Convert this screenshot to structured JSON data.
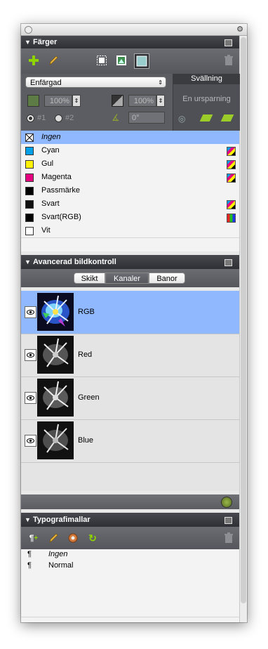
{
  "colors_panel": {
    "title": "Färger",
    "toolbar_icons": [
      "plus-icon",
      "pencil-icon",
      "frame-icon",
      "image-frame-icon",
      "box-fill-icon",
      "trash-icon"
    ],
    "mode_select": "Enfärgad",
    "shade_left": "100%",
    "shade_right": "100%",
    "color1_label": "#1",
    "color2_label": "#2",
    "angle": "0°",
    "blend_header": "Svällning",
    "blend_value": "En ursparning",
    "colors": [
      {
        "name": "Ingen",
        "swatch": "none",
        "badge": "",
        "selected": true,
        "italic": true
      },
      {
        "name": "Cyan",
        "swatch": "#00a0e9",
        "badge": "cmyk"
      },
      {
        "name": "Gul",
        "swatch": "#fff200",
        "badge": "cmyk"
      },
      {
        "name": "Magenta",
        "swatch": "#e4007f",
        "badge": "cmyk"
      },
      {
        "name": "Passmärke",
        "swatch": "#000000",
        "badge": ""
      },
      {
        "name": "Svart",
        "swatch": "#111111",
        "badge": "cmyk"
      },
      {
        "name": "Svart(RGB)",
        "swatch": "#000000",
        "badge": "rgb"
      },
      {
        "name": "Vit",
        "swatch": "#ffffff",
        "badge": ""
      }
    ]
  },
  "image_panel": {
    "title": "Avancerad bildkontroll",
    "tabs": [
      "Skikt",
      "Kanaler",
      "Banor"
    ],
    "active_tab": "Kanaler",
    "channels": [
      {
        "name": "RGB",
        "selected": true
      },
      {
        "name": "Red",
        "selected": false
      },
      {
        "name": "Green",
        "selected": false
      },
      {
        "name": "Blue",
        "selected": false
      }
    ]
  },
  "typo_panel": {
    "title": "Typografimallar",
    "styles": [
      {
        "mark": "¶",
        "name": "Ingen",
        "italic": true
      },
      {
        "mark": "¶",
        "name": "Normal",
        "italic": false
      }
    ]
  },
  "colors": {
    "accent": "#8fb8ff",
    "header_dark": "#3b3d42",
    "toolbar": "#5f6166"
  }
}
